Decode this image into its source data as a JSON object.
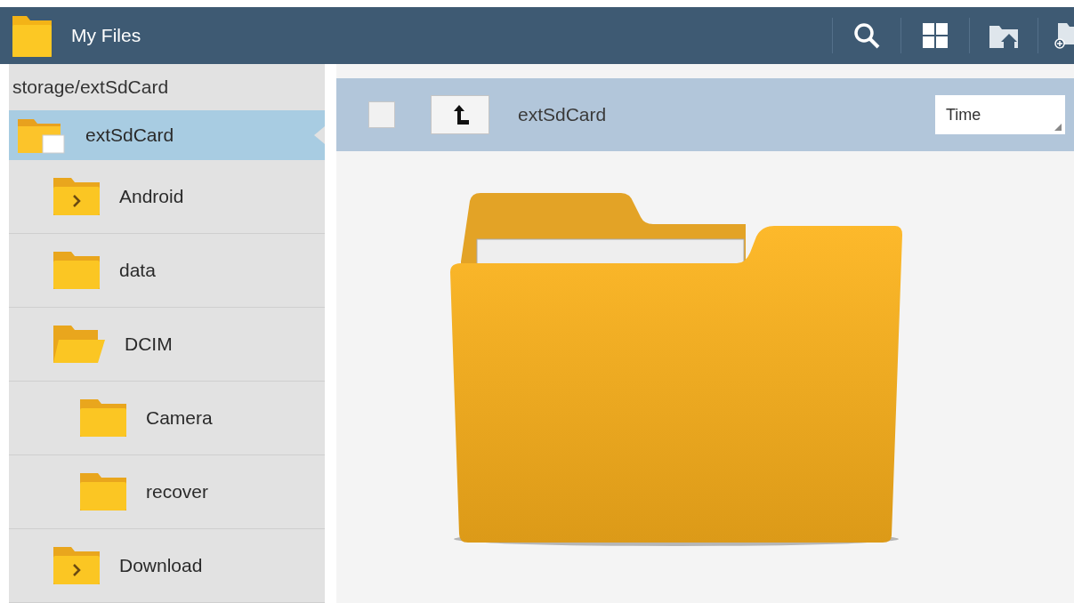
{
  "app_bar": {
    "title": "My Files"
  },
  "sidebar": {
    "path": "storage/extSdCard",
    "tree": [
      {
        "label": "extSdCard",
        "kind": "sdcard",
        "selected": true,
        "children": [
          {
            "label": "Android",
            "kind": "closed",
            "selected": false
          },
          {
            "label": "data",
            "kind": "plain",
            "selected": false
          },
          {
            "label": "DCIM",
            "kind": "open",
            "selected": false,
            "children": [
              {
                "label": "Camera",
                "kind": "plain",
                "selected": false
              },
              {
                "label": "recover",
                "kind": "plain",
                "selected": false
              }
            ]
          },
          {
            "label": "Download",
            "kind": "closed",
            "selected": false
          }
        ]
      }
    ]
  },
  "toolbar": {
    "select_all_checked": false,
    "current_folder": "extSdCard",
    "sort": "Time"
  }
}
